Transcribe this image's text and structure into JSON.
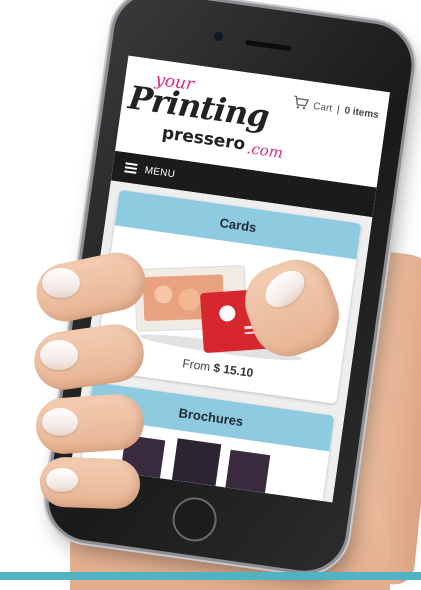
{
  "site": {
    "logo": {
      "your": "your",
      "printing": "Printing",
      "pressero": "pressero",
      "com": ".com"
    },
    "cart": {
      "label": "Cart",
      "separator": "|",
      "count": "0 items"
    },
    "menu": {
      "label": "MENU"
    }
  },
  "products": [
    {
      "title": "Cards",
      "price_prefix": "From",
      "price": "$ 15.10"
    },
    {
      "title": "Brochures"
    }
  ],
  "colors": {
    "header_band": "#8ecbe0",
    "brand_pink": "#e0287f",
    "menu_bar": "#1b1b1b",
    "card_red": "#d6262e",
    "strip": "#4fb3c4"
  },
  "icons": [
    "cart-icon",
    "hamburger-icon"
  ]
}
